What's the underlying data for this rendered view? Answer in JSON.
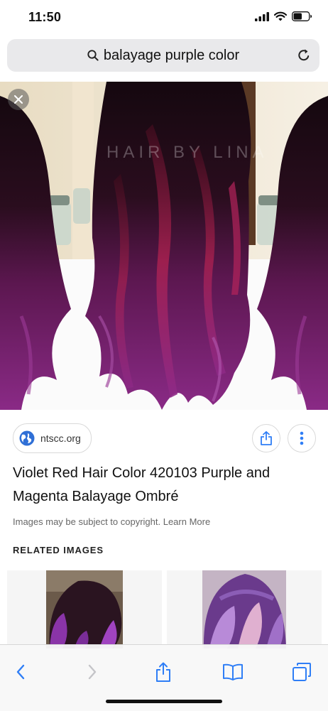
{
  "status_bar": {
    "time": "11:50"
  },
  "search": {
    "query": "balayage purple color",
    "icon": "search-icon",
    "reload_icon": "reload-icon"
  },
  "hero": {
    "watermark": "HAIR BY LINA",
    "close_icon": "close-icon"
  },
  "result": {
    "source": "ntscc.org",
    "title": "Violet Red Hair Color 420103 Purple and Magenta Balayage Ombré",
    "copyright": "Images may be subject to copyright. Learn More"
  },
  "related": {
    "heading": "RELATED IMAGES"
  },
  "toolbar": {
    "icons": [
      "back-icon",
      "forward-icon",
      "share-icon",
      "bookmarks-icon",
      "tabs-icon"
    ]
  },
  "colors": {
    "accent": "#2f7ef6",
    "hair_purple": "#7a1f6e",
    "hair_magenta": "#b3205a"
  }
}
